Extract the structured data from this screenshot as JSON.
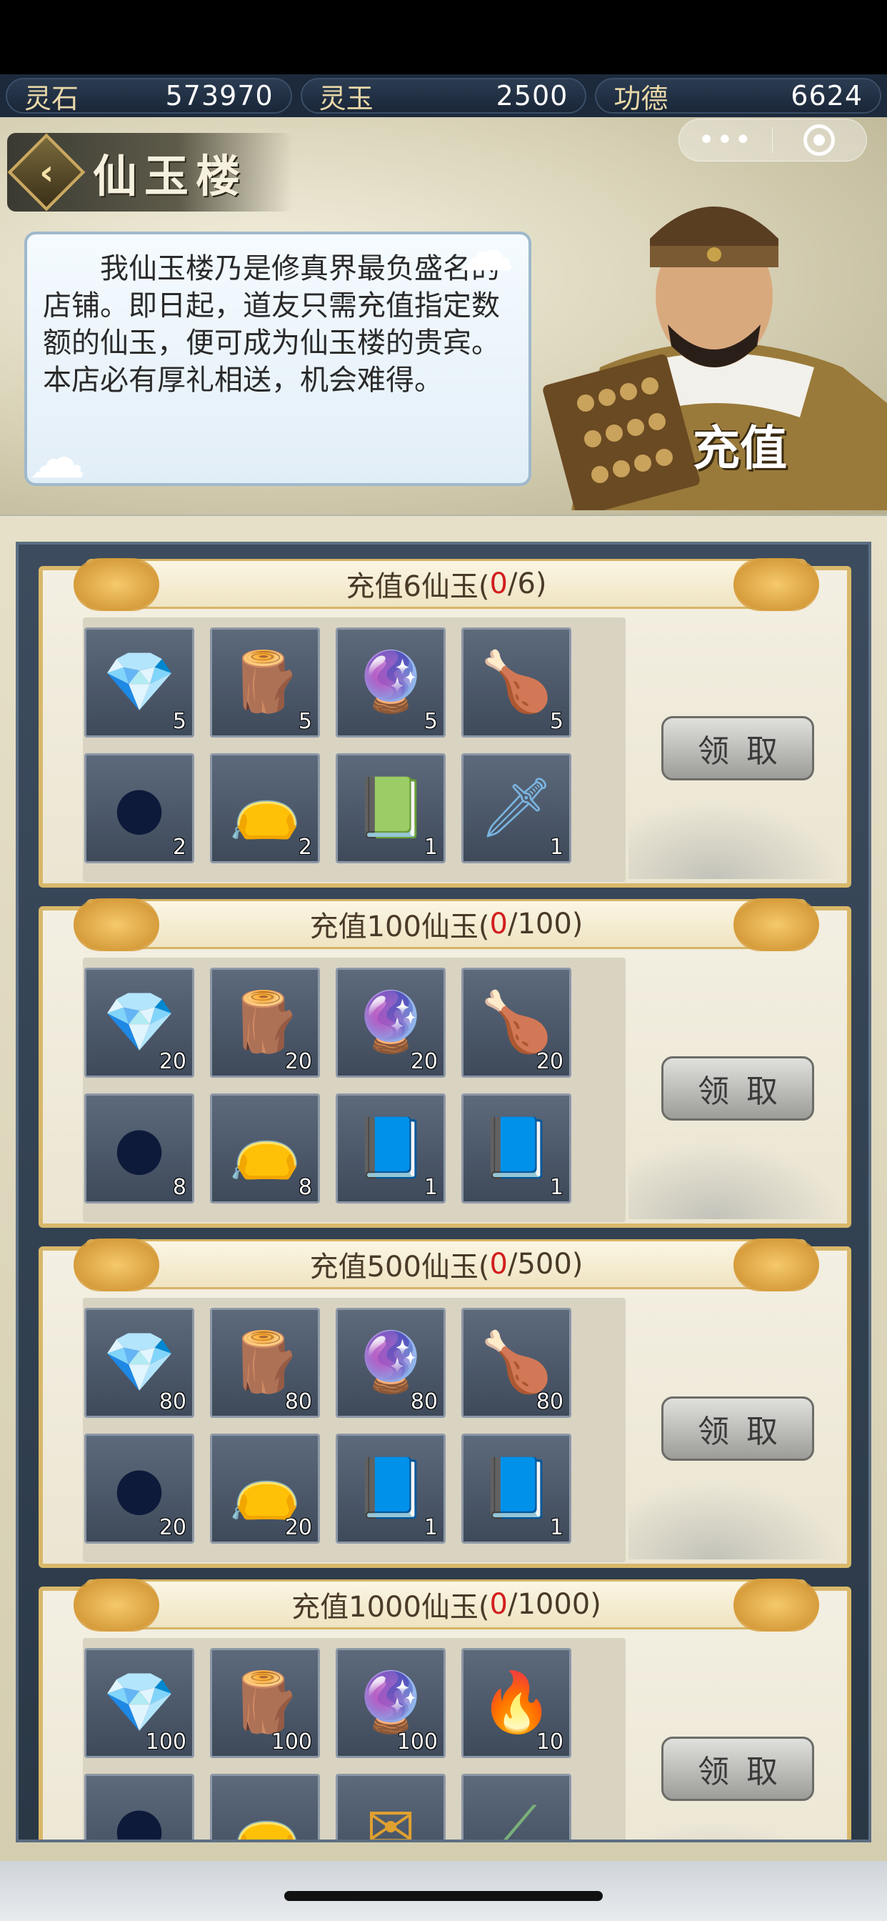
{
  "currency": [
    {
      "label": "灵石",
      "value": "573970"
    },
    {
      "label": "灵玉",
      "value": "2500"
    },
    {
      "label": "功德",
      "value": "6624"
    }
  ],
  "header": {
    "title": "仙玉楼",
    "back_icon": "back-arrow-icon"
  },
  "capsule": {
    "more": "•••",
    "close_icon": "target-icon"
  },
  "speech": "我仙玉楼乃是修真界最负盛名的店铺。即日起，道友只需充值指定数额的仙玉，便可成为仙玉楼的贵宾。本店必有厚礼相送，机会难得。",
  "recharge_label": "充值",
  "claim_label": "领取",
  "tiers": [
    {
      "title_prefix": "充值6仙玉(",
      "progress": "0",
      "title_suffix": "/6)",
      "items": [
        {
          "name": "spirit-stone-bag",
          "count": "5"
        },
        {
          "name": "wood-logs",
          "count": "5"
        },
        {
          "name": "purple-crystal",
          "count": "5"
        },
        {
          "name": "roast-duck",
          "count": "5"
        },
        {
          "name": "dark-orb",
          "count": "2"
        },
        {
          "name": "green-pouch",
          "count": "2"
        },
        {
          "name": "green-book",
          "count": "1"
        },
        {
          "name": "blue-sword",
          "count": "1"
        }
      ]
    },
    {
      "title_prefix": "充值100仙玉(",
      "progress": "0",
      "title_suffix": "/100)",
      "items": [
        {
          "name": "spirit-stone-bag",
          "count": "20"
        },
        {
          "name": "wood-logs",
          "count": "20"
        },
        {
          "name": "purple-crystal",
          "count": "20"
        },
        {
          "name": "roast-duck",
          "count": "20"
        },
        {
          "name": "dark-orb",
          "count": "8"
        },
        {
          "name": "green-pouch",
          "count": "8"
        },
        {
          "name": "blue-book",
          "count": "1"
        },
        {
          "name": "blue-book",
          "count": "1"
        }
      ]
    },
    {
      "title_prefix": "充值500仙玉(",
      "progress": "0",
      "title_suffix": "/500)",
      "items": [
        {
          "name": "spirit-stone-bag",
          "count": "80"
        },
        {
          "name": "wood-logs",
          "count": "80"
        },
        {
          "name": "purple-crystal",
          "count": "80"
        },
        {
          "name": "roast-duck",
          "count": "80"
        },
        {
          "name": "dark-orb",
          "count": "20"
        },
        {
          "name": "green-pouch",
          "count": "20"
        },
        {
          "name": "blue-book",
          "count": "1"
        },
        {
          "name": "blue-book",
          "count": "1"
        }
      ]
    },
    {
      "title_prefix": "充值1000仙玉(",
      "progress": "0",
      "title_suffix": "/1000)",
      "items": [
        {
          "name": "spirit-stone-bag",
          "count": "100"
        },
        {
          "name": "wood-logs",
          "count": "100"
        },
        {
          "name": "purple-crystal",
          "count": "100"
        },
        {
          "name": "purple-flame",
          "count": "10"
        },
        {
          "name": "dark-orb",
          "count": ""
        },
        {
          "name": "blue-pouch",
          "count": ""
        },
        {
          "name": "letter-envelope",
          "count": ""
        },
        {
          "name": "jade-horn",
          "count": ""
        }
      ]
    }
  ]
}
